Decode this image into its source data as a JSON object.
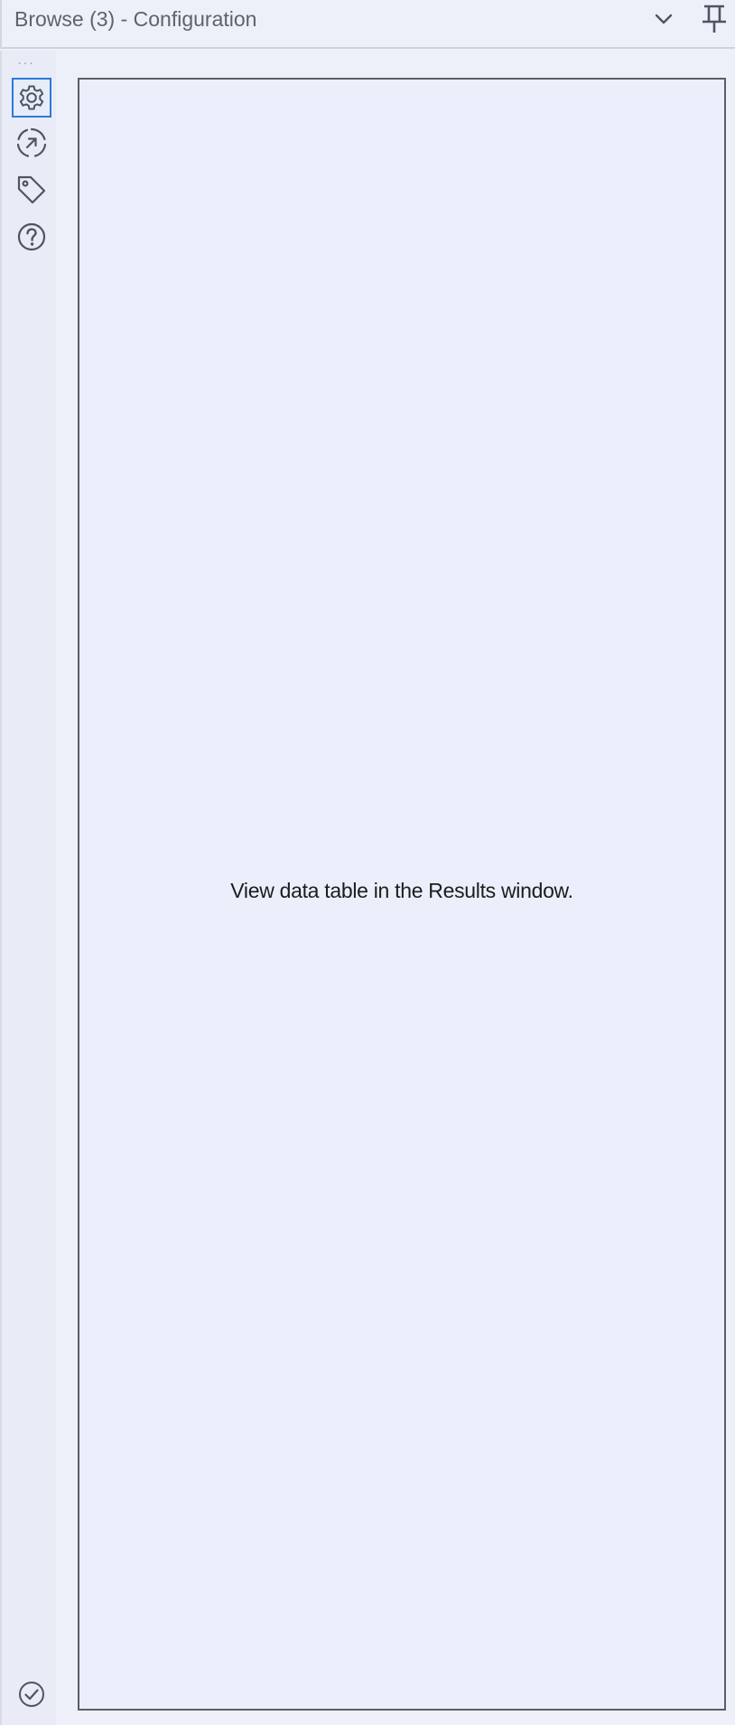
{
  "window": {
    "title": "Browse (3) - Configuration",
    "icons": {
      "dropdown": "chevron-down-icon",
      "pin": "pin-icon"
    }
  },
  "sidebar": {
    "overflow": "...",
    "items": [
      {
        "icon": "gear-icon",
        "active": true
      },
      {
        "icon": "navigate-arrow-icon",
        "active": false
      },
      {
        "icon": "tag-icon",
        "active": false
      },
      {
        "icon": "help-circle-icon",
        "active": false
      }
    ],
    "footer_icon": "check-circle-icon"
  },
  "content": {
    "message": "View data table in the Results window."
  },
  "colors": {
    "background": "#edf0f9",
    "accent": "#2f79d8",
    "icon": "#4f5461",
    "panel_border": "#5a5e66"
  }
}
